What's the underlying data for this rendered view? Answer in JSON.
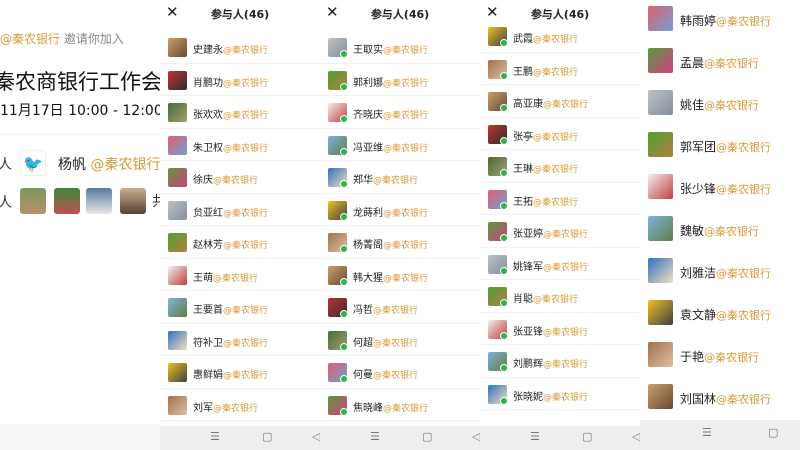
{
  "panel1": {
    "inviter_org": "@秦农银行",
    "inviter_text": " 邀请你加入",
    "title": "秦农商银行工作会",
    "time": "11月17日 10:00 - 12:00",
    "host_label": "人",
    "host_name": "杨帆",
    "host_org": " @秦农银行",
    "participants_label": "人",
    "more": "共"
  },
  "header": {
    "title": "参与人(46)",
    "close": "✕"
  },
  "org": "@秦农银行",
  "panel2": [
    "史建永",
    "肖鹏功",
    "张欢欢",
    "朱卫权",
    "徐庆",
    "贠亚红",
    "赵林芳",
    "王萌",
    "王要首",
    "符补卫",
    "惠鲜娟",
    "刘军"
  ],
  "panel3": [
    "王取实",
    "郭利娜",
    "齐晓庆",
    "冯亚维",
    "郑华",
    "龙蒔利",
    "杨菁阁",
    "韩大猩",
    "冯哲",
    "何超",
    "何曼",
    "焦晓峰"
  ],
  "panel4": [
    "武霞",
    "王鹏",
    "高亚康",
    "张亭",
    "王琳",
    "王拓",
    "张亚婷",
    "姚锋军",
    "肖聪",
    "张亚锋",
    "刘鹏辉",
    "张晓妮"
  ],
  "panel5": [
    "韩雨婷",
    "孟晨",
    "姚佳",
    "郭军团",
    "张少锋",
    "魏敏",
    "刘雅洁",
    "袁文静",
    "于艳",
    "刘国林"
  ],
  "nav": {
    "menu": "☰",
    "home": "▢",
    "back": "◁"
  },
  "colors": {
    "accent": "#d89a3a",
    "check": "#2fb34a"
  }
}
